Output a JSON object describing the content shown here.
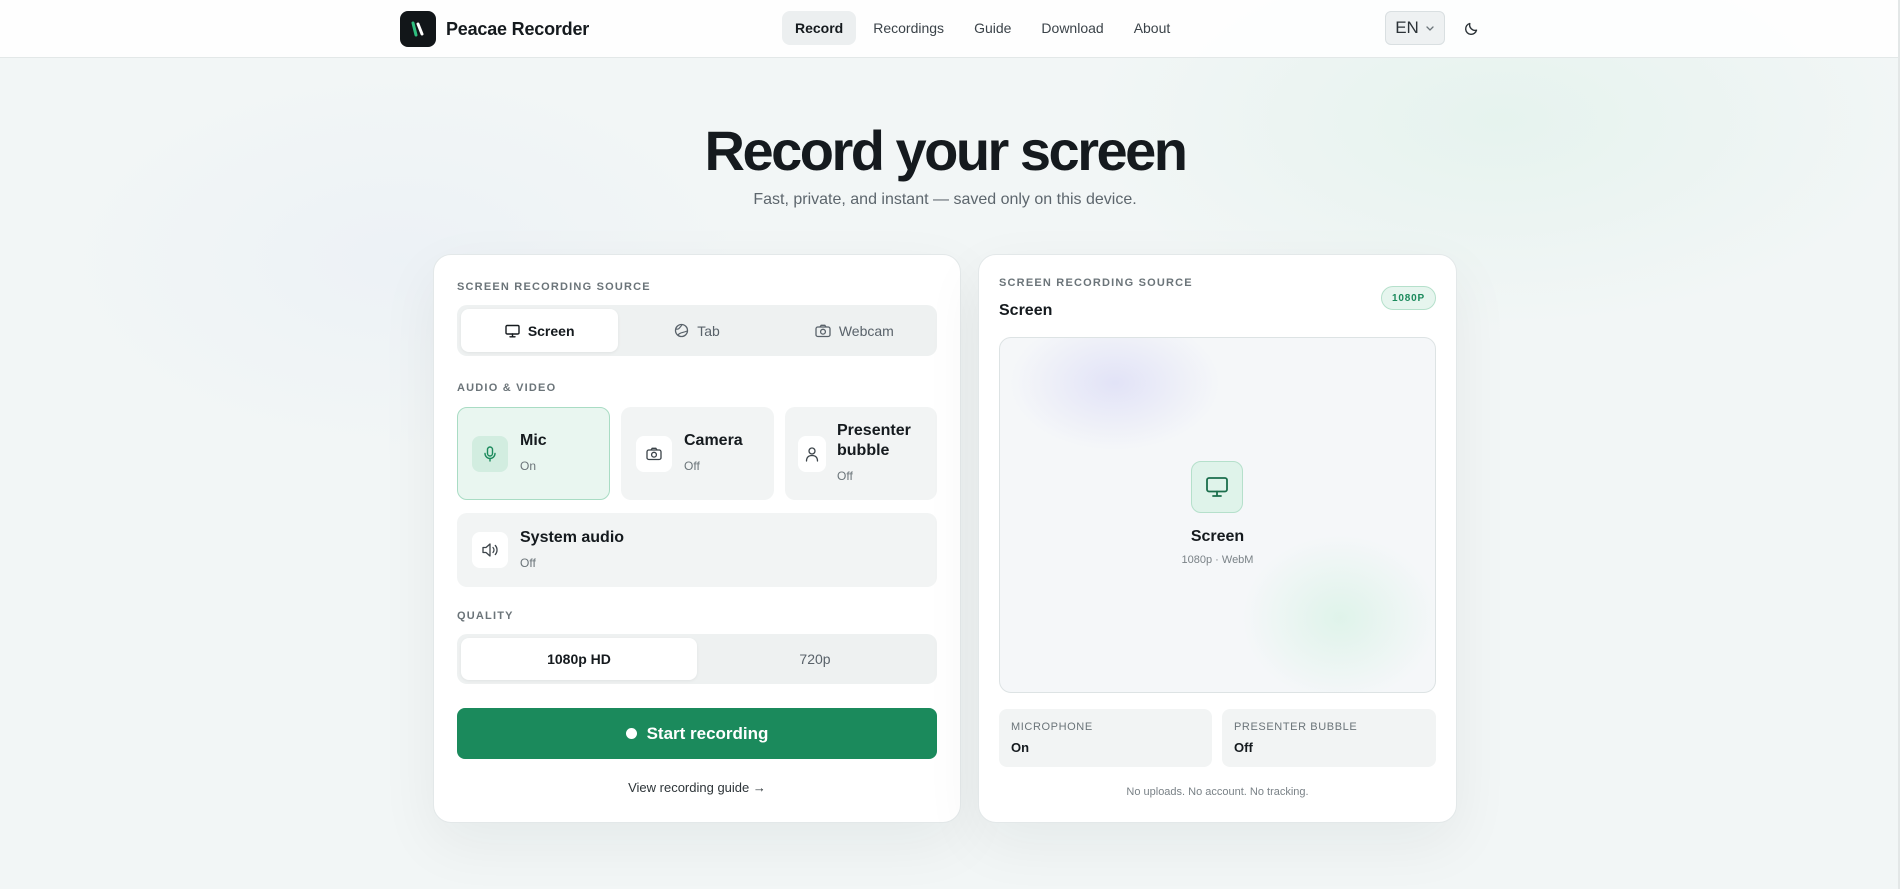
{
  "brand": {
    "name": "Peacae Recorder"
  },
  "nav": {
    "links": [
      {
        "label": "Record",
        "active": true
      },
      {
        "label": "Recordings",
        "active": false
      },
      {
        "label": "Guide",
        "active": false
      },
      {
        "label": "Download",
        "active": false
      },
      {
        "label": "About",
        "active": false
      }
    ],
    "language": "EN",
    "theme_icon": "moon-icon"
  },
  "hero": {
    "title": "Record your screen",
    "subtitle": "Fast, private, and instant — saved only on this device."
  },
  "settings": {
    "source_label": "SCREEN RECORDING SOURCE",
    "sources": [
      {
        "label": "Screen",
        "icon": "monitor-icon",
        "active": true
      },
      {
        "label": "Tab",
        "icon": "globe-icon",
        "active": false
      },
      {
        "label": "Webcam",
        "icon": "camera-icon",
        "active": false
      }
    ],
    "audio_video_label": "AUDIO & VIDEO",
    "toggles": {
      "mic": {
        "name": "Mic",
        "state": "On",
        "icon": "microphone-icon"
      },
      "camera": {
        "name": "Camera",
        "state": "Off",
        "icon": "camera-icon"
      },
      "presenter": {
        "name_line1": "Presenter",
        "name_line2": "bubble",
        "state": "Off",
        "icon": "person-icon"
      },
      "system_audio": {
        "name": "System audio",
        "state": "Off",
        "icon": "speaker-icon"
      }
    },
    "quality_label": "QUALITY",
    "qualities": [
      {
        "label": "1080p HD",
        "active": true
      },
      {
        "label": "720p",
        "active": false
      }
    ],
    "start_label": "Start recording",
    "guide_link": "View recording guide →"
  },
  "preview": {
    "source_label": "SCREEN RECORDING SOURCE",
    "source_value": "Screen",
    "resolution_badge": "1080P",
    "screen_name": "Screen",
    "screen_meta": "1080p · WebM",
    "stats": [
      {
        "label": "MICROPHONE",
        "value": "On"
      },
      {
        "label": "PRESENTER BUBBLE",
        "value": "Off"
      }
    ],
    "privacy_note": "No uploads. No account. No tracking."
  },
  "colors": {
    "accent": "#1b8a5c",
    "accent_light": "#e9f6f0",
    "text": "#151a1e"
  }
}
